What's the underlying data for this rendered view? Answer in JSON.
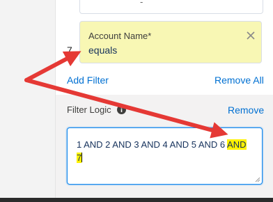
{
  "filter": {
    "prev_partial": "-",
    "number": "7.",
    "field_label": "Account Name*",
    "operator": "equals"
  },
  "actions": {
    "add_filter": "Add Filter",
    "remove_all": "Remove All"
  },
  "logic": {
    "label": "Filter Logic",
    "remove": "Remove",
    "text_main": "1 AND 2 AND 3 AND 4 AND 5 AND 6 ",
    "text_highlight_1": "AND",
    "text_highlight_2": "7"
  },
  "colors": {
    "highlight": "#fff200",
    "card": "#f8f7b4",
    "link": "#0070d2",
    "arrow": "#e53935"
  },
  "icons": {
    "close": "close-icon",
    "info": "info-icon",
    "resize": "resize-handle-icon"
  }
}
